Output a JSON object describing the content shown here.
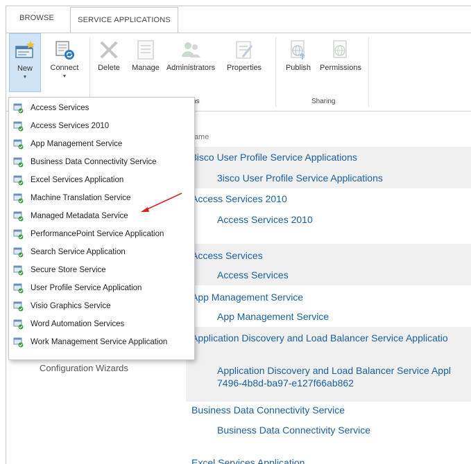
{
  "tabs": {
    "browse": "BROWSE",
    "service_applications": "SERVICE APPLICATIONS"
  },
  "ribbon": {
    "new": "New",
    "connect": "Connect",
    "delete": "Delete",
    "manage": "Manage",
    "administrators": "Administrators",
    "properties": "Properties",
    "publish": "Publish",
    "permissions": "Permissions",
    "group_operations_partial": "ns",
    "group_sharing": "Sharing"
  },
  "new_menu": [
    "Access Services",
    "Access Services 2010",
    "App Management Service",
    "Business Data Connectivity Service",
    "Excel Services Application",
    "Machine Translation Service",
    "Managed Metadata Service",
    "PerformancePoint Service Application",
    "Search Service Application",
    "Secure Store Service",
    "User Profile Service Application",
    "Visio Graphics Service",
    "Word Automation Services",
    "Work Management Service Application"
  ],
  "list": {
    "column_name": "Name",
    "rows": [
      {
        "text": "3isco User Profile Service Applications",
        "level": 1
      },
      {
        "text": "3isco User Profile Service Applications",
        "level": 2
      },
      {
        "text": "Access Services 2010",
        "level": 1
      },
      {
        "text": "Access Services 2010",
        "level": 2
      },
      {
        "text": "Access Services",
        "level": 1
      },
      {
        "text": "Access Services",
        "level": 2
      },
      {
        "text": "App Management Service",
        "level": 1
      },
      {
        "text": "App Management Service",
        "level": 2
      },
      {
        "text": "Application Discovery and Load Balancer Service Applicatio",
        "level": 1
      },
      {
        "text": "Application Discovery and Load Balancer Service Appl",
        "text2": "7496-4b8d-ba97-e127f66ab862",
        "level": 2
      },
      {
        "text": "Business Data Connectivity Service",
        "level": 1
      },
      {
        "text": "Business Data Connectivity Service",
        "level": 2
      },
      {
        "text": "Excel Services Application",
        "level": 1
      }
    ]
  },
  "left_nav": {
    "configuration_wizards": "Configuration Wizards"
  },
  "colors": {
    "link": "#1a5fa0",
    "ribbon_selected": "#d0e4f5",
    "annotation_arrow": "#e02020"
  }
}
